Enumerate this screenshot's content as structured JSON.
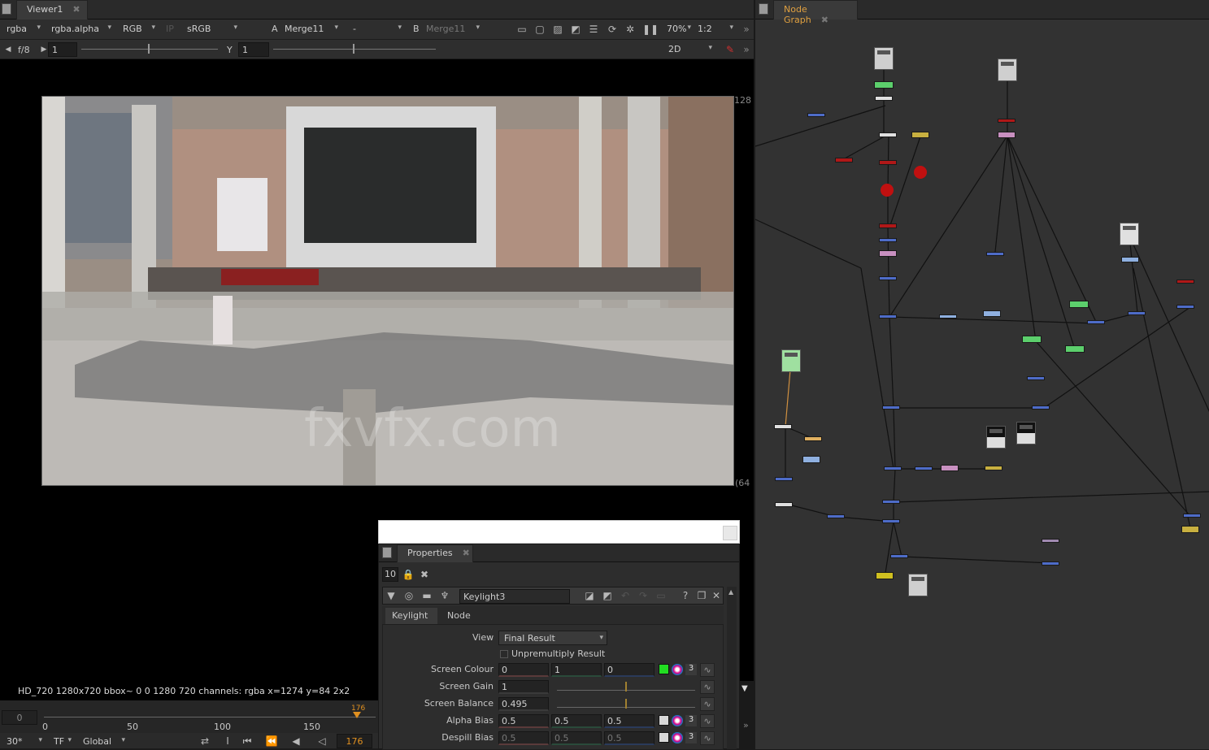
{
  "viewer": {
    "tab_label": "Viewer1",
    "toolbar1": {
      "channels": "rgba",
      "alpha_channel": "rgba.alpha",
      "display_channels": "RGB",
      "ip_label": "IP",
      "lut": "sRGB",
      "a_label": "A",
      "a_input": "Merge11",
      "composite_op": "-",
      "b_label": "B",
      "b_input": "Merge11",
      "zoom": "70%",
      "proxy": "1:2"
    },
    "toolbar2": {
      "fstop": "f/8",
      "gain_value": "1",
      "y_label": "Y",
      "gamma_value": "1",
      "view_mode": "2D"
    },
    "image_label_right_top": "128",
    "image_label_right_bottom": "(64",
    "watermark": "fxvfx.com",
    "status_text": "HD_720 1280x720  bbox~ 0 0 1280 720 channels: rgba    x=1274 y=84 2x2",
    "timeline": {
      "current_frame_left": "0",
      "ticks": [
        "0",
        "50",
        "100",
        "150"
      ],
      "playhead": "176",
      "fps": "30*",
      "tf_label": "TF",
      "scope": "Global",
      "frame_field": "176"
    }
  },
  "node_graph": {
    "tab_label": "Node Graph"
  },
  "properties": {
    "tab_label": "Properties",
    "max_panels": "10",
    "node_name": "Keylight3",
    "tabs": [
      "Keylight",
      "Node"
    ],
    "view_label": "View",
    "view_value": "Final Result",
    "unpremultiply_label": "Unpremultiply Result",
    "rows": [
      {
        "label": "Screen Colour",
        "values": [
          "0",
          "1",
          "0"
        ],
        "count": "3",
        "swatch": "#22dd22"
      },
      {
        "label": "Screen Gain",
        "values": [
          "1"
        ]
      },
      {
        "label": "Screen Balance",
        "values": [
          "0.495"
        ]
      },
      {
        "label": "Alpha Bias",
        "values": [
          "0.5",
          "0.5",
          "0.5"
        ],
        "count": "3",
        "swatch": "#d8d8d8"
      },
      {
        "label": "Despill Bias",
        "values": [
          "0.5",
          "0.5",
          "0.5"
        ],
        "count": "3",
        "swatch": "#d8d8d8"
      }
    ]
  }
}
